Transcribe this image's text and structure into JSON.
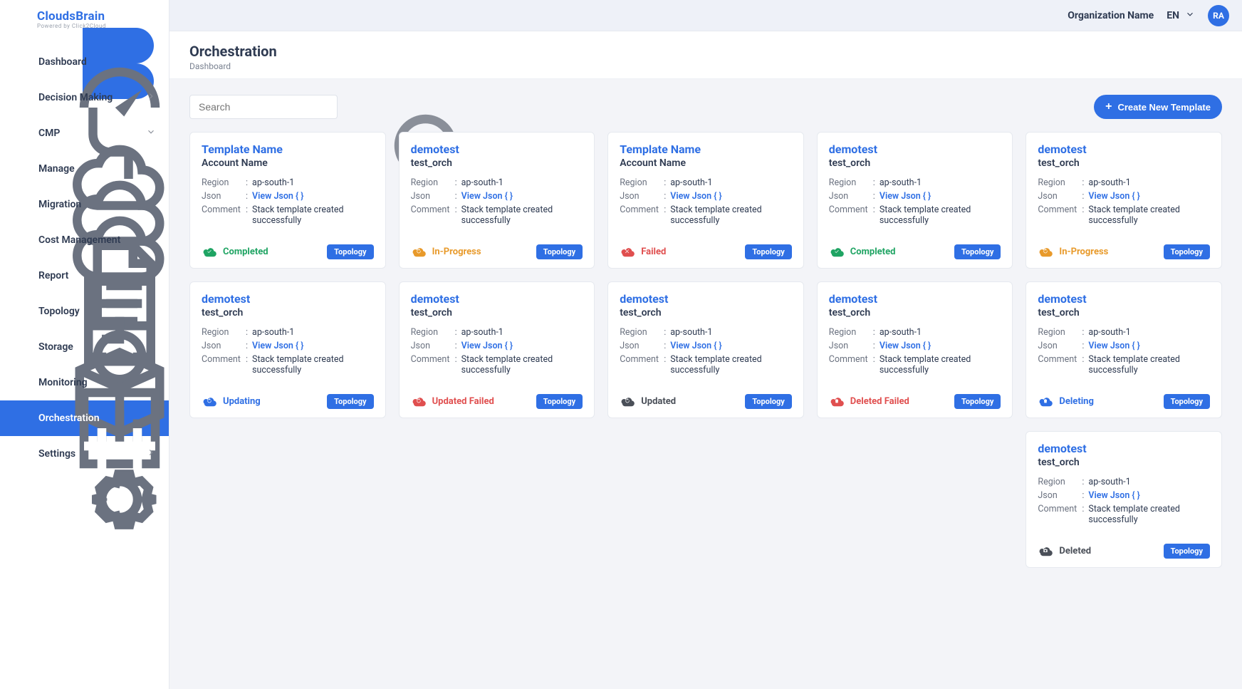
{
  "brand": {
    "name": "CloudsBrain",
    "tagline": "Powered by Click2Cloud"
  },
  "header": {
    "org": "Organization Name",
    "lang": "EN",
    "avatar": "RA"
  },
  "page": {
    "title": "Orchestration",
    "breadcrumb": "Dashboard"
  },
  "search": {
    "placeholder": "Search"
  },
  "actions": {
    "create": "Create New Template"
  },
  "labels": {
    "region": "Region",
    "json": "Json",
    "comment": "Comment",
    "viewJson": "View Json { }"
  },
  "nav": [
    {
      "label": "Dashboard",
      "icon": "dashboard"
    },
    {
      "label": "Decision Making",
      "icon": "decision",
      "chev": "right"
    },
    {
      "label": "CMP",
      "icon": "cmp",
      "chev": "down"
    },
    {
      "label": "Manage",
      "icon": "manage"
    },
    {
      "label": "Migration",
      "icon": "migration"
    },
    {
      "label": "Cost Management",
      "icon": "cost"
    },
    {
      "label": "Report",
      "icon": "report"
    },
    {
      "label": "Topology",
      "icon": "topology"
    },
    {
      "label": "Storage",
      "icon": "storage"
    },
    {
      "label": "Monitoring",
      "icon": "monitoring"
    },
    {
      "label": "Orchestration",
      "icon": "orchestration",
      "active": true
    },
    {
      "label": "Settings",
      "icon": "settings",
      "chev": "right"
    }
  ],
  "cards": [
    {
      "title": "Template Name",
      "account": "Account Name",
      "region": "ap-south-1",
      "comment": "Stack template created successfully",
      "status": "Completed",
      "statusKey": "completed",
      "topology": "Topology"
    },
    {
      "title": "demotest",
      "account": "test_orch",
      "region": "ap-south-1",
      "comment": "Stack template created successfully",
      "status": "In-Progress",
      "statusKey": "inprogress",
      "topology": "Topology"
    },
    {
      "title": "Template Name",
      "account": "Account Name",
      "region": "ap-south-1",
      "comment": "Stack template created successfully",
      "status": "Failed",
      "statusKey": "failed",
      "topology": "Topology"
    },
    {
      "title": "demotest",
      "account": "test_orch",
      "region": "ap-south-1",
      "comment": "Stack template created successfully",
      "status": "Completed",
      "statusKey": "completed",
      "topology": "Topology"
    },
    {
      "title": "demotest",
      "account": "test_orch",
      "region": "ap-south-1",
      "comment": "Stack template created successfully",
      "status": "In-Progress",
      "statusKey": "inprogress",
      "topology": "Topology"
    },
    {
      "title": "demotest",
      "account": "test_orch",
      "region": "ap-south-1",
      "comment": "Stack template created successfully",
      "status": "Updating",
      "statusKey": "updating",
      "topology": "Topology"
    },
    {
      "title": "demotest",
      "account": "test_orch",
      "region": "ap-south-1",
      "comment": "Stack template created successfully",
      "status": "Updated Failed",
      "statusKey": "updatedfailed",
      "topology": "Topology"
    },
    {
      "title": "demotest",
      "account": "test_orch",
      "region": "ap-south-1",
      "comment": "Stack template created successfully",
      "status": "Updated",
      "statusKey": "updated",
      "topology": "Topology"
    },
    {
      "title": "demotest",
      "account": "test_orch",
      "region": "ap-south-1",
      "comment": "Stack template created successfully",
      "status": "Deleted Failed",
      "statusKey": "deletedfailed",
      "topology": "Topology"
    },
    {
      "title": "demotest",
      "account": "test_orch",
      "region": "ap-south-1",
      "comment": "Stack template created successfully",
      "status": "Deleting",
      "statusKey": "deleting",
      "topology": "Topology"
    },
    {
      "title": "demotest",
      "account": "test_orch",
      "region": "ap-south-1",
      "comment": "Stack template created successfully",
      "status": "Deleted",
      "statusKey": "deleted",
      "topology": "Topology",
      "offset": true
    }
  ]
}
